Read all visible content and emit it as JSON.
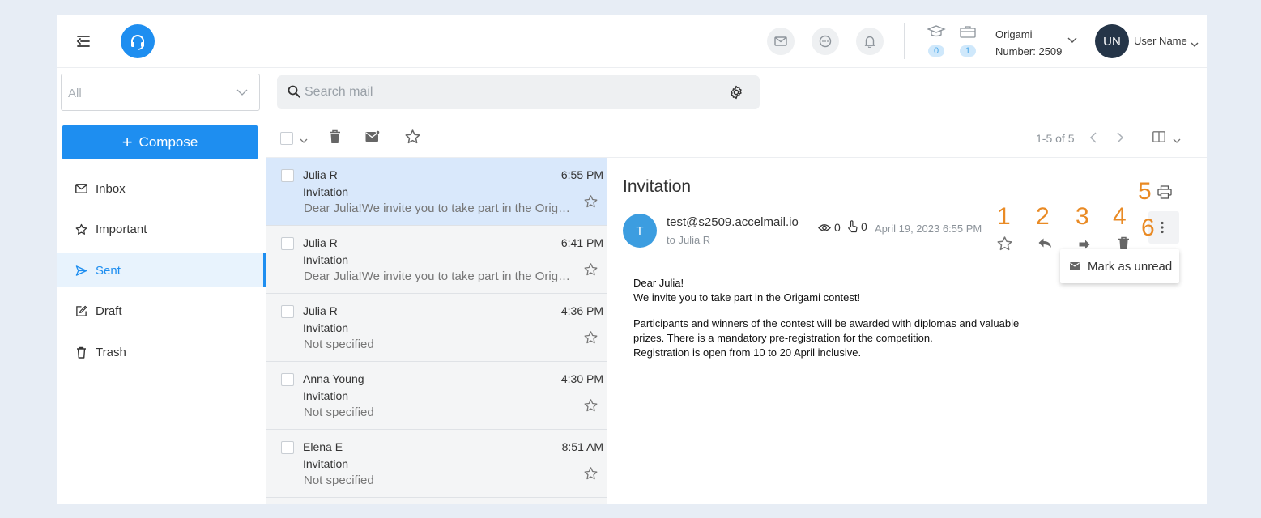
{
  "header": {
    "stats": [
      {
        "icon": "graduation-cap-icon",
        "count": "0"
      },
      {
        "icon": "briefcase-icon",
        "count": "1"
      }
    ],
    "org_name": "Origami",
    "org_number": "Number: 2509",
    "user_initials": "UN",
    "user_name": "User Name"
  },
  "folder_select": {
    "value": "All"
  },
  "search": {
    "placeholder": "Search mail"
  },
  "sidebar": {
    "compose_label": "Compose",
    "items": [
      {
        "label": "Inbox",
        "icon": "mail-icon"
      },
      {
        "label": "Important",
        "icon": "star-icon"
      },
      {
        "label": "Sent",
        "icon": "send-icon",
        "active": true
      },
      {
        "label": "Draft",
        "icon": "draft-icon"
      },
      {
        "label": "Trash",
        "icon": "trash-icon"
      }
    ]
  },
  "toolbar": {
    "pager": "1-5 of 5"
  },
  "messages": [
    {
      "sender": "Julia R",
      "time": "6:55 PM",
      "subject": "Invitation",
      "preview": "Dear Julia!We invite you to take part in the Origami contest!",
      "selected": true
    },
    {
      "sender": "Julia R",
      "time": "6:41 PM",
      "subject": "Invitation",
      "preview": "Dear Julia!We invite you to take part in the Origami contest!"
    },
    {
      "sender": "Julia R",
      "time": "4:36 PM",
      "subject": "Invitation",
      "preview": "Not specified"
    },
    {
      "sender": "Anna Young",
      "time": "4:30 PM",
      "subject": "Invitation",
      "preview": "Not specified"
    },
    {
      "sender": "Elena E",
      "time": "8:51 AM",
      "subject": "Invitation",
      "preview": "Not specified"
    }
  ],
  "email": {
    "subject": "Invitation",
    "sender_initial": "T",
    "from": "test@s2509.accelmail.io",
    "to": "to Julia R",
    "views": "0",
    "clicks": "0",
    "date": "April 19, 2023 6:55 PM",
    "annotations": [
      "1",
      "2",
      "3",
      "4",
      "5",
      "6"
    ],
    "menu_item": "Mark as unread",
    "body": [
      "Dear Julia!",
      "We invite you to take part in the Origami contest!",
      "Participants and winners of the contest will be awarded with diplomas and valuable prizes. There is a mandatory pre-registration for the competition.",
      "Registration is open from 10 to 20 April inclusive."
    ]
  },
  "colors": {
    "accent": "#1e8ef0",
    "annotation": "#e98a24",
    "selected_row": "#d9e8fb"
  }
}
